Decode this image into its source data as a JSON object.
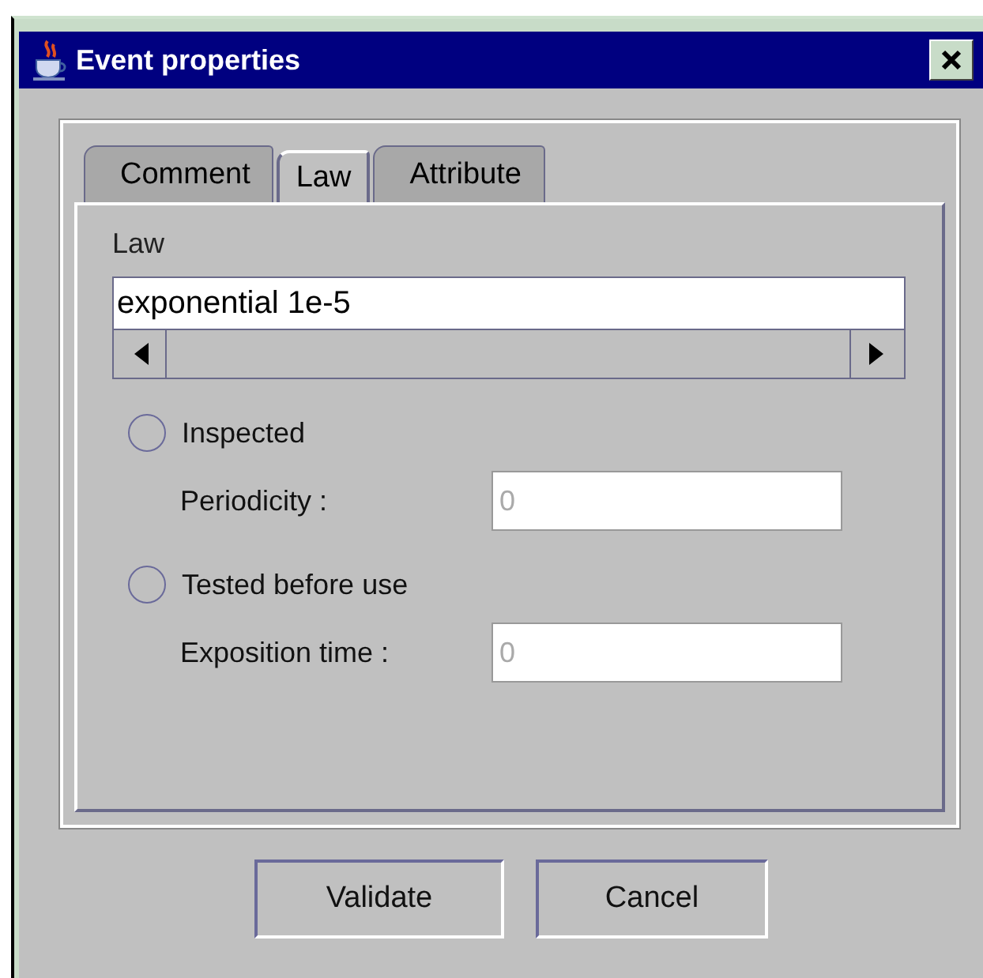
{
  "window": {
    "title": "Event properties"
  },
  "tabs": [
    {
      "label": "Comment",
      "selected": false
    },
    {
      "label": "Law",
      "selected": true
    },
    {
      "label": "Attribute",
      "selected": false
    }
  ],
  "law": {
    "label": "Law",
    "value": "exponential 1e-5"
  },
  "options": [
    {
      "label": "Inspected",
      "selected": false,
      "field_label": "Periodicity :",
      "field_value": "0",
      "field_disabled": true
    },
    {
      "label": "Tested before use",
      "selected": false,
      "field_label": "Exposition time :",
      "field_value": "0",
      "field_disabled": true
    }
  ],
  "buttons": [
    "Validate",
    "Cancel"
  ]
}
